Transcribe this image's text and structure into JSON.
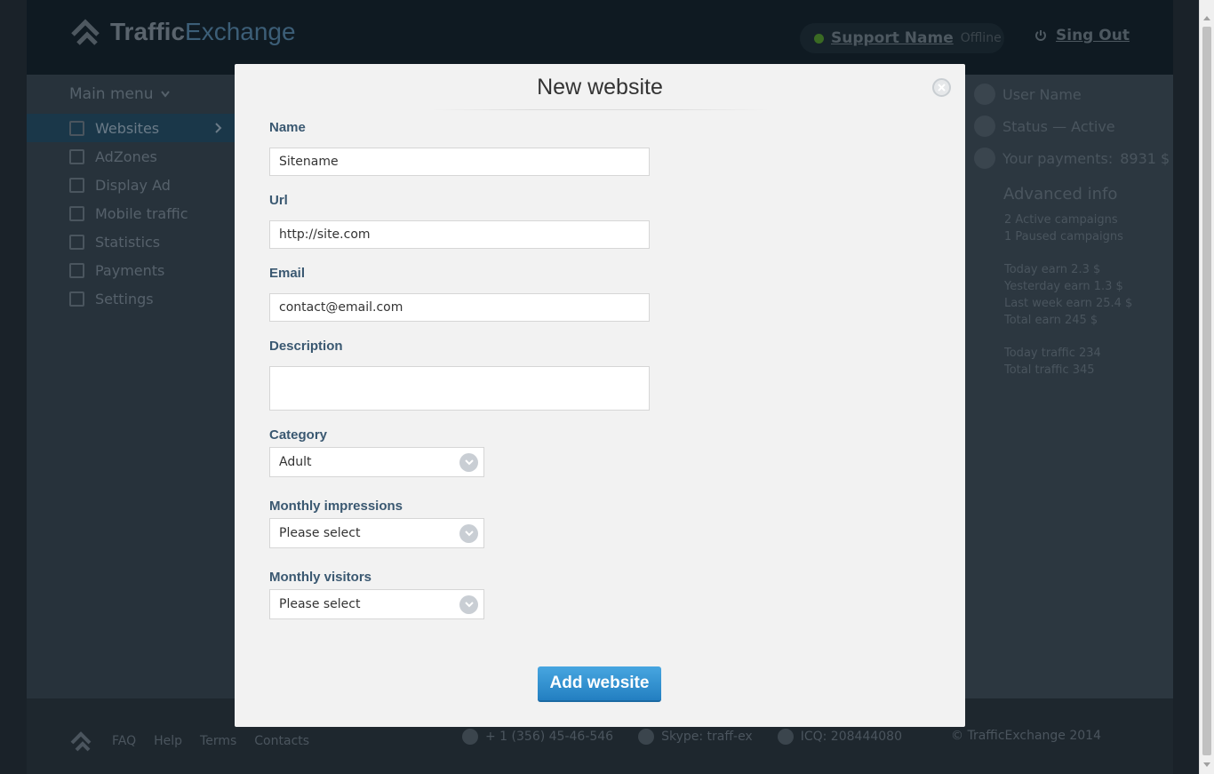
{
  "app": {
    "logo_bold": "Traffic",
    "logo_light": "Exchange"
  },
  "header": {
    "support_name": "Support Name",
    "support_status": "Offline",
    "signout_label": "Sing Out"
  },
  "sidebar": {
    "menu_title": "Main menu",
    "items": [
      {
        "label": "Websites",
        "icon": "website-icon"
      },
      {
        "label": "AdZones",
        "icon": "flag-icon"
      },
      {
        "label": "Display Ad",
        "icon": "flag-plus-icon"
      },
      {
        "label": "Mobile traffic",
        "icon": "flag-plus-icon"
      },
      {
        "label": "Statistics",
        "icon": "chart-icon"
      },
      {
        "label": "Payments",
        "icon": "gear-icon"
      },
      {
        "label": "Settings",
        "icon": "settings-icon"
      }
    ]
  },
  "user_panel": {
    "user_name": "User Name",
    "status": "Status — Active",
    "payments_label": "Your payments:",
    "payments_value": "8931 $",
    "advanced_title": "Advanced info",
    "campaigns": [
      "2 Active campaigns",
      "1 Paused campaigns"
    ],
    "earnings": [
      "Today earn 2.3 $",
      "Yesterday earn 1.3 $",
      "Last week earn 25.4 $",
      "Total earn 245 $"
    ],
    "traffic": [
      "Today traffic 234",
      "Total traffic 345"
    ]
  },
  "footer": {
    "links": [
      "FAQ",
      "Help",
      "Terms",
      "Contacts"
    ],
    "phone": "+ 1 (356) 45-46-546",
    "skype": "Skype: traff-ex",
    "icq": "ICQ: 208444080",
    "copyright": "© TrafficExchange 2014"
  },
  "modal": {
    "title": "New website",
    "name_label": "Name",
    "name_value": "Sitename",
    "url_label": "Url",
    "url_value": "http://site.com",
    "email_label": "Email",
    "email_value": "contact@email.com",
    "description_label": "Description",
    "description_value": "",
    "category_label": "Category",
    "category_value": "Adult",
    "impressions_label": "Monthly impressions",
    "impressions_value": "Please select",
    "visitors_label": "Monthly visitors",
    "visitors_value": "Please select",
    "submit_label": "Add website"
  },
  "colors": {
    "accent": "#2b8fd3",
    "label": "#3a5871",
    "status_offline": "#3a6a23"
  }
}
